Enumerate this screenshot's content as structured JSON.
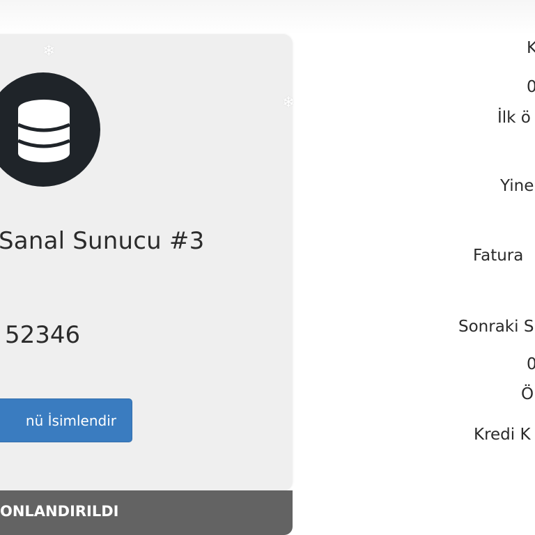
{
  "product_card": {
    "title": "Sanal Sunucu #3",
    "id_value": "52346",
    "rename_button_label": "nü İsimlendir",
    "status_label": "ONLANDIRILDI",
    "icon": "database-icon"
  },
  "info_panel": {
    "rows": [
      "K",
      "0",
      "İlk ö",
      "Yine",
      "Fatura",
      "Sonraki S",
      "0",
      "Ö",
      "Kredi K"
    ]
  },
  "colors": {
    "card_background": "#efefef",
    "icon_circle": "#1f2429",
    "button_blue": "#3a7cc0",
    "status_bar": "#636363"
  }
}
